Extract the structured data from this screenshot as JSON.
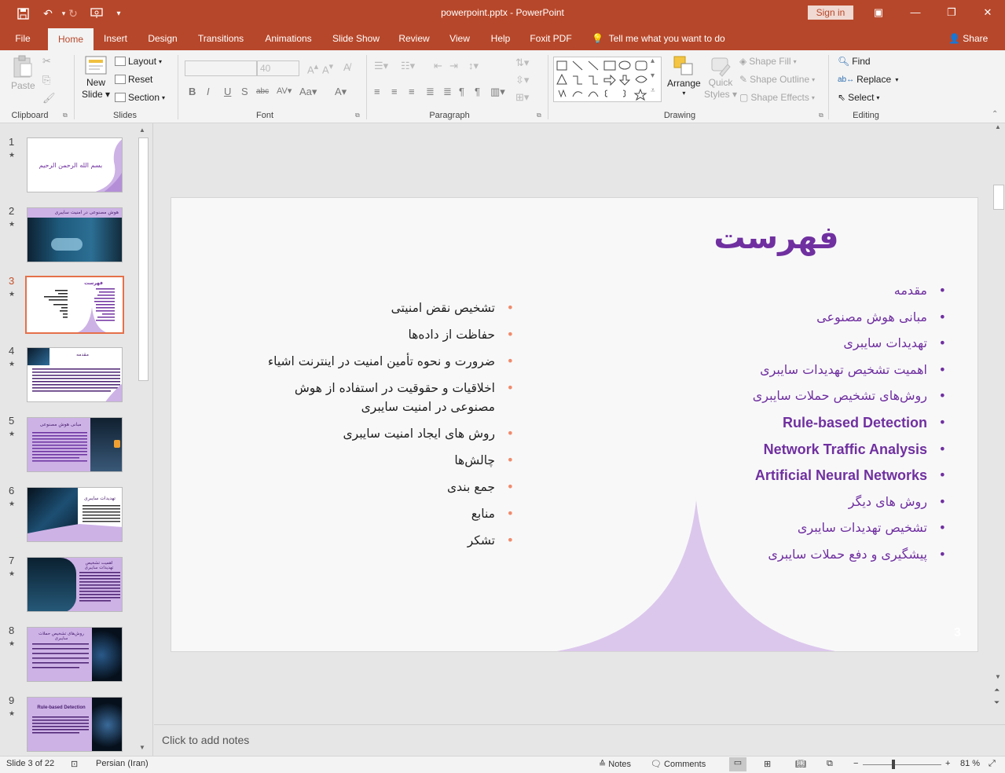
{
  "titlebar": {
    "title": "powerpoint.pptx  -  PowerPoint",
    "signin": "Sign in"
  },
  "tabs": [
    {
      "label": "File"
    },
    {
      "label": "Home"
    },
    {
      "label": "Insert"
    },
    {
      "label": "Design"
    },
    {
      "label": "Transitions"
    },
    {
      "label": "Animations"
    },
    {
      "label": "Slide Show"
    },
    {
      "label": "Review"
    },
    {
      "label": "View"
    },
    {
      "label": "Help"
    },
    {
      "label": "Foxit PDF"
    }
  ],
  "tell_me": "Tell me what you want to do",
  "share": "Share",
  "ribbon": {
    "clipboard": {
      "paste": "Paste",
      "label": "Clipboard"
    },
    "slides": {
      "new_slide": "New",
      "new_slide2": "Slide",
      "layout": "Layout",
      "reset": "Reset",
      "section": "Section",
      "label": "Slides"
    },
    "font": {
      "size": "40",
      "label": "Font"
    },
    "paragraph": {
      "label": "Paragraph"
    },
    "drawing": {
      "arrange": "Arrange",
      "quick_styles": "Quick",
      "quick_styles2": "Styles",
      "shape_fill": "Shape Fill",
      "shape_outline": "Shape Outline",
      "shape_effects": "Shape Effects",
      "label": "Drawing"
    },
    "editing": {
      "find": "Find",
      "replace": "Replace",
      "select": "Select",
      "label": "Editing"
    }
  },
  "thumbnails": [
    {
      "num": "1",
      "title": "بسم الله الرحمن الرحیم"
    },
    {
      "num": "2",
      "title": "هوش مصنوعی در امنیت سایبری"
    },
    {
      "num": "3",
      "title": "فهرست"
    },
    {
      "num": "4",
      "title": "مقدمه"
    },
    {
      "num": "5",
      "title": "مبانی هوش مصنوعی"
    },
    {
      "num": "6",
      "title": "تهدیدات سایبری"
    },
    {
      "num": "7",
      "title": "اهمیت تشخیص تهدیدات سایبری"
    },
    {
      "num": "8",
      "title": "روش‌های تشخیص حملات سایبری"
    },
    {
      "num": "9",
      "title": "Rule-based Detection"
    }
  ],
  "slide": {
    "title": "فهرست",
    "right_items": [
      {
        "text": "مقدمه",
        "en": false
      },
      {
        "text": "مبانی هوش مصنوعی",
        "en": false
      },
      {
        "text": "تهدیدات سایبری",
        "en": false
      },
      {
        "text": "اهمیت تشخیص تهدیدات سایبری",
        "en": false
      },
      {
        "text": "روش‌های تشخیص حملات سایبری",
        "en": false
      },
      {
        "text": "Rule-based Detection",
        "en": true
      },
      {
        "text": "Network Traffic Analysis",
        "en": true
      },
      {
        "text": "Artificial Neural Networks",
        "en": true
      },
      {
        "text": "روش های دیگر",
        "en": false
      },
      {
        "text": "تشخیص تهدیدات سایبری",
        "en": false
      },
      {
        "text": "پیشگیری و دفع حملات سایبری",
        "en": false
      }
    ],
    "left_items": [
      "تشخیص نقض امنیتی",
      "حفاظت از داده‌ها",
      "ضرورت و نحوه تأمین امنیت در اینترنت اشیاء",
      "اخلاقیات و حقوقیت در استفاده از هوش مصنوعی در امنیت سایبری",
      "روش های ایجاد امنیت سایبری",
      "چالش‌ها",
      "جمع بندی",
      "منابع",
      "تشکر"
    ],
    "number": "3"
  },
  "notes_placeholder": "Click to add notes",
  "status": {
    "slide_of": "Slide 3 of 22",
    "language": "Persian (Iran)",
    "notes": "Notes",
    "comments": "Comments",
    "zoom": "81 %"
  }
}
